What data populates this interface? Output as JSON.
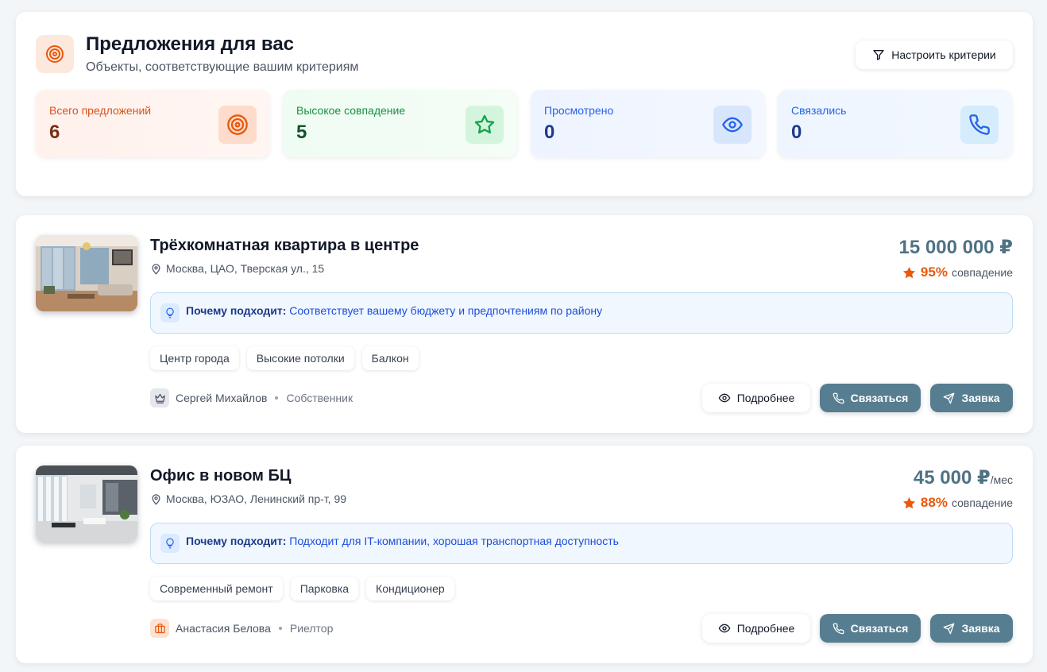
{
  "header": {
    "title": "Предложения для вас",
    "subtitle": "Объекты, соответствующие вашим критериям",
    "criteria_button": "Настроить критерии"
  },
  "stats": [
    {
      "label": "Всего предложений",
      "value": "6",
      "icon": "target-icon"
    },
    {
      "label": "Высокое совпадение",
      "value": "5",
      "icon": "star-icon"
    },
    {
      "label": "Просмотрено",
      "value": "0",
      "icon": "eye-icon"
    },
    {
      "label": "Связались",
      "value": "0",
      "icon": "phone-icon"
    }
  ],
  "listings": [
    {
      "title": "Трёхкомнатная квартира в центре",
      "address": "Москва, ЦАО, Тверская ул., 15",
      "price": "15 000 000 ₽",
      "price_unit": "",
      "match_percent": "95%",
      "match_label": "совпадение",
      "why_label": "Почему подходит:",
      "why_text": "Соответствует вашему бюджету и предпочтениям по району",
      "tags": [
        "Центр города",
        "Высокие потолки",
        "Балкон"
      ],
      "owner_name": "Сергей Михайлов",
      "owner_role": "Собственник",
      "owner_icon": "crown-icon",
      "details_button": "Подробнее",
      "contact_button": "Связаться",
      "request_button": "Заявка"
    },
    {
      "title": "Офис в новом БЦ",
      "address": "Москва, ЮЗАО, Ленинский пр-т, 99",
      "price": "45 000 ₽",
      "price_unit": "/мес",
      "match_percent": "88%",
      "match_label": "совпадение",
      "why_label": "Почему подходит:",
      "why_text": "Подходит для IT-компании, хорошая транспортная доступность",
      "tags": [
        "Современный ремонт",
        "Парковка",
        "Кондиционер"
      ],
      "owner_name": "Анастасия Белова",
      "owner_role": "Риелтор",
      "owner_icon": "briefcase-icon",
      "details_button": "Подробнее",
      "contact_button": "Связаться",
      "request_button": "Заявка"
    }
  ],
  "colors": {
    "primary_button": "#577d90",
    "price": "#4f7285",
    "match_accent": "#ea580c",
    "why_text": "#1d4ed8"
  }
}
